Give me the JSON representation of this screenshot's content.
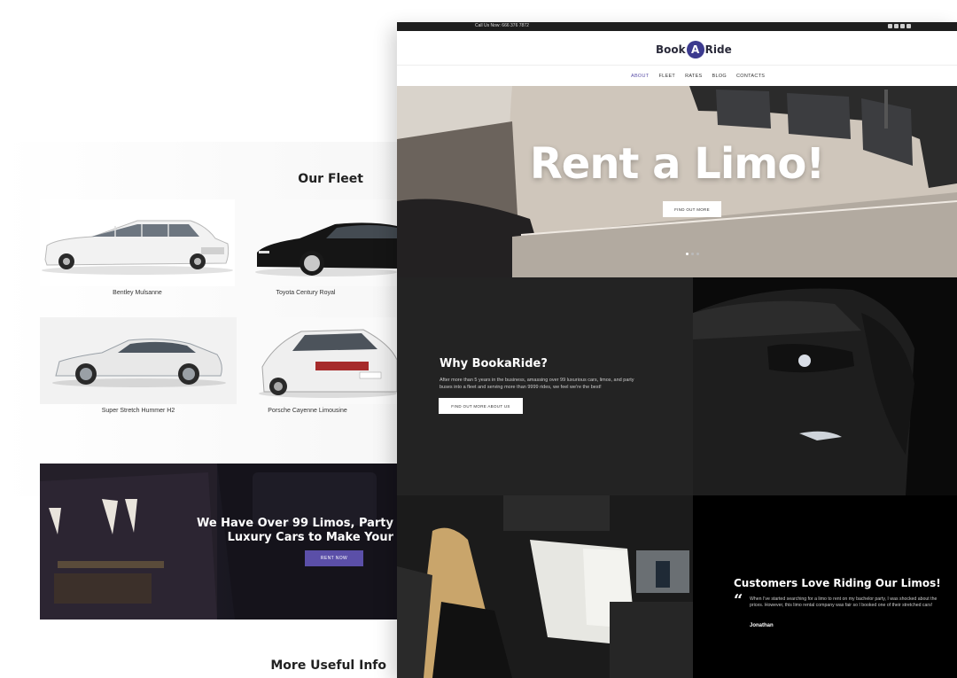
{
  "back_page": {
    "fleet_heading": "Our Fleet",
    "fleet": [
      {
        "name": "Bentley Mulsanne"
      },
      {
        "name": "Toyota Century Royal"
      },
      {
        "name": "Super Stretch Hummer H2"
      },
      {
        "name": "Porsche Cayenne Limousine"
      }
    ],
    "promo": {
      "line1": "We Have Over 99 Limos, Party",
      "line2": "Luxury Cars to Make Your",
      "button": "RENT NOW"
    },
    "more_info_heading": "More Useful Info"
  },
  "front_page": {
    "topbar": {
      "phone": "Call Us Now: 666 376 7872"
    },
    "logo": {
      "left": "Book",
      "mark": "A",
      "right": "Ride"
    },
    "nav": [
      {
        "label": "ABOUT",
        "active": true
      },
      {
        "label": "FLEET"
      },
      {
        "label": "RATES"
      },
      {
        "label": "BLOG"
      },
      {
        "label": "CONTACTS"
      }
    ],
    "hero": {
      "title": "Rent a Limo!",
      "button": "FIND OUT MORE"
    },
    "why": {
      "title": "Why BookaRide?",
      "text": "After more than 5 years in the business, amassing over 99 luxurious cars, limos, and party buses into a fleet and serving more than 9999 rides, we feel we're the best!",
      "button": "FIND OUT MORE ABOUT US"
    },
    "reviews": {
      "title": "Customers Love Riding Our Limos!",
      "quote": "When I've started searching for a limo to rent on my bachelor party, I was shocked about the prices. However, this limo rental company was fair so I booked one of their stretched cars!",
      "author": "Jonathan"
    }
  },
  "colors": {
    "accent": "#5b4fa8",
    "logo_circle": "#3c3a8f",
    "dark": "#232323"
  }
}
